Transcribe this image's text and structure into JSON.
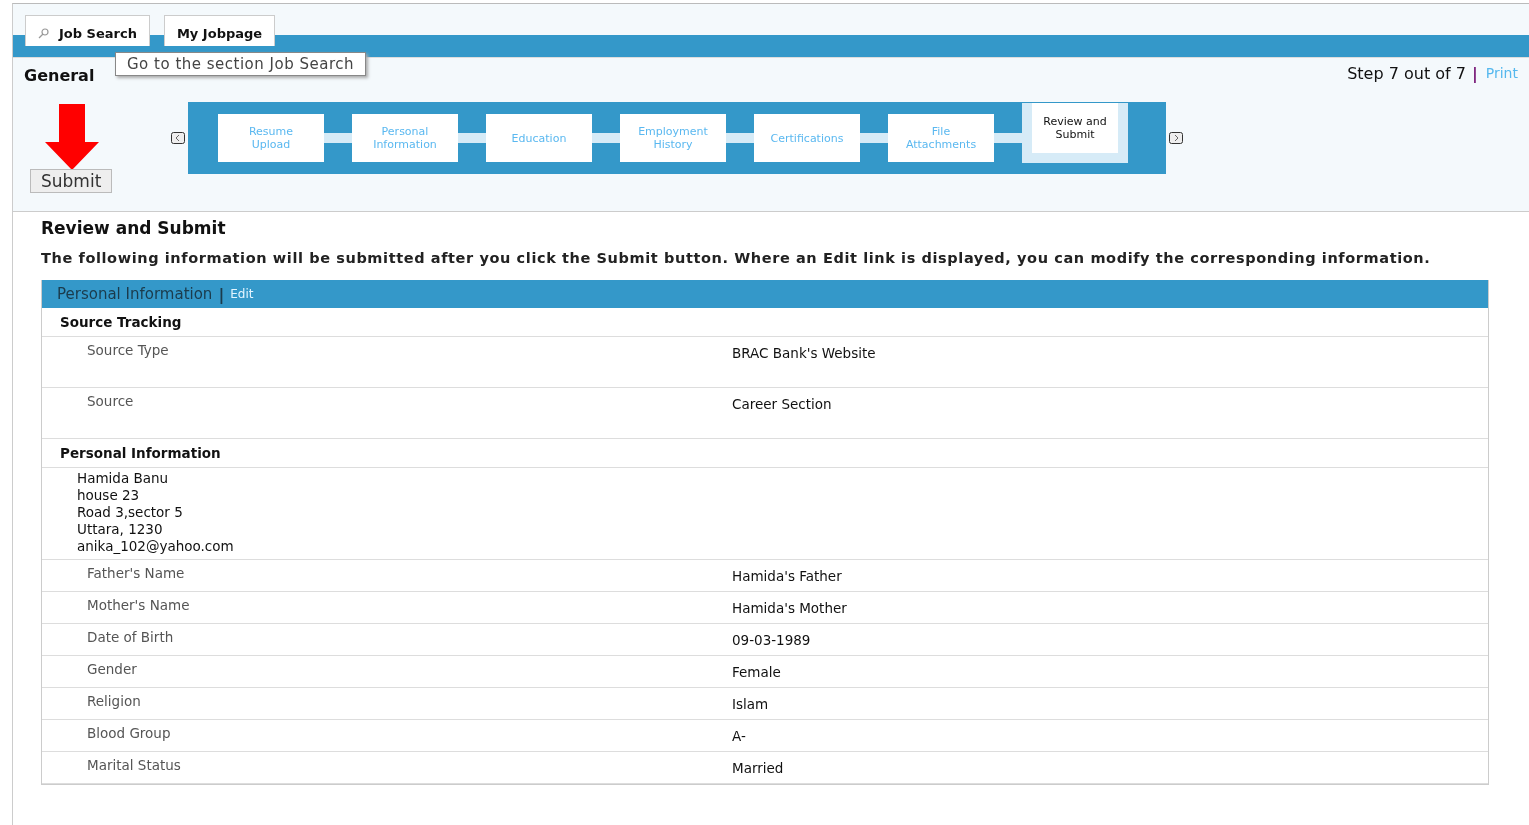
{
  "top_tabs": [
    {
      "label": "Job Search",
      "kind": "search"
    },
    {
      "label": "My Jobpage",
      "kind": "plain"
    }
  ],
  "tooltip": "Go to the section Job Search",
  "header": {
    "title": "General",
    "step": "Step 7 out of 7",
    "separator": "|",
    "print": "Print"
  },
  "steps": [
    {
      "label": "Resume Upload",
      "selected": false
    },
    {
      "label": "Personal Information",
      "selected": false
    },
    {
      "label": "Education",
      "selected": false
    },
    {
      "label": "Employment History",
      "selected": false
    },
    {
      "label": "Certifications",
      "selected": false
    },
    {
      "label": "File Attachments",
      "selected": false
    },
    {
      "label": "Review and Submit",
      "selected": true
    }
  ],
  "submit_button": "Submit",
  "heading": "Review and Submit",
  "description": "The following information will be submitted after you click the Submit button. Where an Edit link is displayed, you can modify the corresponding information.",
  "panel": {
    "title": "Personal Information",
    "separator": "|",
    "edit": "Edit",
    "groups": [
      {
        "title": "Source Tracking",
        "fields": [
          {
            "label": "Source Type",
            "value": "BRAC Bank's Website"
          },
          {
            "label": "Source",
            "value": "Career Section"
          }
        ]
      },
      {
        "title": "Personal Information",
        "address": [
          "Hamida Banu",
          "house 23",
          "Road 3,sector 5",
          "Uttara, 1230",
          "anika_102@yahoo.com"
        ],
        "fields": [
          {
            "label": "Father's Name",
            "value": "Hamida's Father"
          },
          {
            "label": "Mother's Name",
            "value": "Hamida's Mother"
          },
          {
            "label": "Date of Birth",
            "value": "09-03-1989"
          },
          {
            "label": "Gender",
            "value": "Female"
          },
          {
            "label": "Religion",
            "value": "Islam"
          },
          {
            "label": "Blood Group",
            "value": "A-"
          },
          {
            "label": "Marital Status",
            "value": "Married"
          }
        ]
      }
    ]
  }
}
